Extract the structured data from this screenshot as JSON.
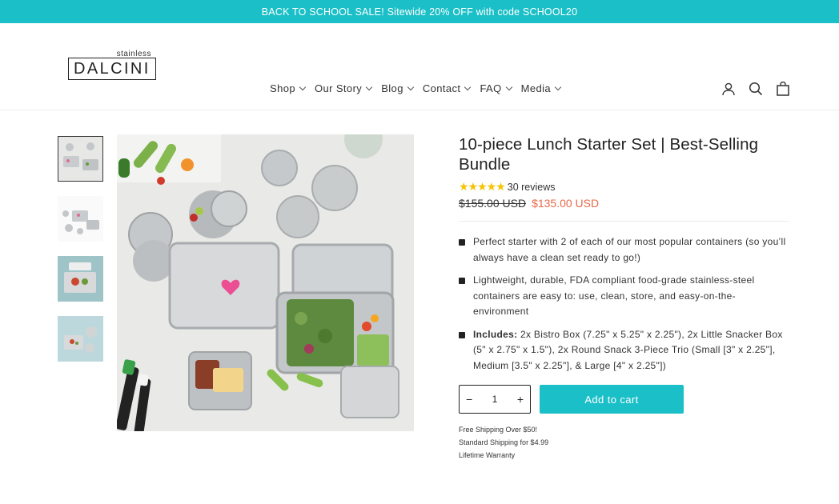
{
  "announcement": "BACK TO SCHOOL SALE! Sitewide 20% OFF with code SCHOOL20",
  "logo": {
    "small": "stainless",
    "brand": "DALCINI"
  },
  "nav": [
    {
      "label": "Shop"
    },
    {
      "label": "Our Story"
    },
    {
      "label": "Blog"
    },
    {
      "label": "Contact"
    },
    {
      "label": "FAQ"
    },
    {
      "label": "Media"
    }
  ],
  "header_icons": [
    "user-icon",
    "search-icon",
    "bag-icon"
  ],
  "product": {
    "title": "10-piece Lunch Starter Set | Best-Selling Bundle",
    "stars": "★★★★★",
    "reviews": "30 reviews",
    "old_price": "$155.00 USD",
    "price": "$135.00 USD",
    "features": [
      {
        "bold": "",
        "text": "Perfect starter with 2 of each of our most popular containers (so you’ll always have a clean set ready to go!)"
      },
      {
        "bold": "",
        "text": "Lightweight, durable,  FDA compliant food-grade stainless-steel containers are easy to: use, clean, store, and easy-on-the-environment"
      },
      {
        "bold": "Includes:",
        "text": " 2x Bistro Box (7.25\" x 5.25\" x 2.25\"), 2x Little Snacker Box (5\" x 2.75\" x 1.5\"), 2x Round Snack 3-Piece Trio (Small [3\" x 2.25\"], Medium [3.5\" x 2.25\"], & Large [4\" x 2.25\"])"
      }
    ],
    "quantity": "1",
    "minus": "−",
    "plus": "+",
    "add_to_cart": "Add to cart",
    "notes": [
      "Free Shipping Over $50!",
      "Standard Shipping for $4.99",
      "Lifetime Warranty"
    ]
  },
  "colors": {
    "accent": "#1bbfc7",
    "sale": "#e96a4a",
    "stars": "#f5c300"
  }
}
